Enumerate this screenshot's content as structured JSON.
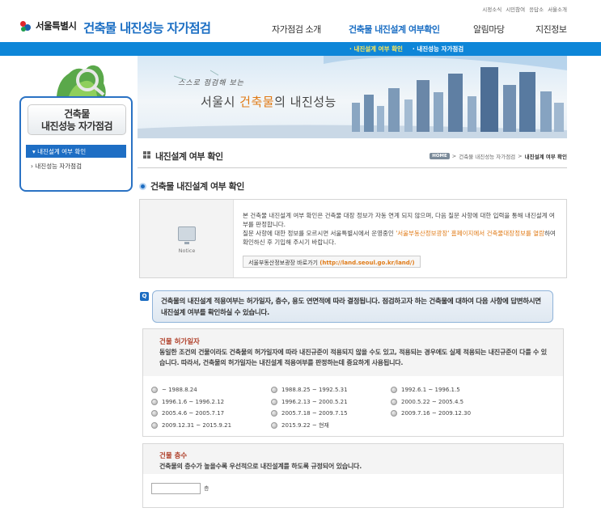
{
  "util_links": [
    "시정소식",
    "시민참여",
    "응답소",
    "서울소개"
  ],
  "logo": {
    "org": "서울특별시",
    "site_title": "건축물 내진성능 자가점검"
  },
  "gnb": [
    {
      "label": "자가점검 소개",
      "active": false
    },
    {
      "label": "건축물 내진설계 여부확인",
      "active": true
    },
    {
      "label": "알림마당",
      "active": false
    },
    {
      "label": "지진정보",
      "active": false
    }
  ],
  "subnav": [
    "· 내진설계 여부 확인",
    "· 내진성능 자가점검"
  ],
  "sidebar": {
    "title_line1": "건축물",
    "title_line2": "내진성능 자가점검",
    "items": [
      "내진설계 여부 확인",
      "내진성능 자가점검"
    ]
  },
  "banner": {
    "small_text": "스스로 점검해 보는",
    "big_pre": "서울시 ",
    "big_hl": "건축물",
    "big_post": "의 내진성능"
  },
  "page_heading": {
    "title": "내진설계 여부 확인",
    "home": "HOME",
    "crumb1": "건축물 내진성능 자가점검",
    "crumb_current": "내진설계 여부 확인"
  },
  "section_title": "건축물 내진설계 여부 확인",
  "notice": {
    "label": "Notice",
    "para1": "본 건축물 내진설계 여부 확인은 건축물 대장 정보가 자동 연계 되지 않으며, 다음 질문 사항에 대한 입력을 통해 내진설계 여부를 판정합니다.",
    "para2_pre": "질문 사항에 대한 정보를 모르시면 서울특별시에서 운영중인 ",
    "para2_hl": "'서울부동산정보광장' 홈페이지에서 건축물대장정보를 열람",
    "para2_post": "하여 확인하신 후 기입해 주시기 바랍니다.",
    "button_label": "서울부동산정보광장 바로가기",
    "button_url": "(http://land.seoul.go.kr/land/)"
  },
  "q_box": {
    "badge": "Q",
    "text": "건축물의 내진설계 적용여부는 허가일자, 층수, 용도 연면적에 따라 결정됩니다. 점검하고자 하는 건축물에 대하여 다음 사항에 답변하시면 내진설계 여부를 확인하실 수 있습니다."
  },
  "question1": {
    "label": "건물 허가일자",
    "desc": "동일한 조건의 건물이라도 건축물의 허가일자에 따라 내진규준이 적용되지 않을 수도 있고, 적용되는 경우에도 실제 적용되는 내진규준이 다를 수 있습니다. 따라서, 건축물의 허가일자는 내진설계 적용여부를 판정하는데 중요하게 사용됩니다.",
    "options": [
      "~ 1988.8.24",
      "1988.8.25 ~ 1992.5.31",
      "1992.6.1 ~ 1996.1.5",
      "1996.1.6 ~ 1996.2.12",
      "1996.2.13 ~ 2000.5.21",
      "2000.5.22 ~ 2005.4.5",
      "2005.4.6 ~ 2005.7.17",
      "2005.7.18 ~ 2009.7.15",
      "2009.7.16 ~ 2009.12.30",
      "2009.12.31 ~ 2015.9.21",
      "2015.9.22 ~ 현재"
    ]
  },
  "question2": {
    "label": "건물 층수",
    "desc": "건축물의 층수가 높을수록 우선적으로 내진설계를 하도록 규정되어 있습니다.",
    "value": "",
    "unit": "층"
  }
}
